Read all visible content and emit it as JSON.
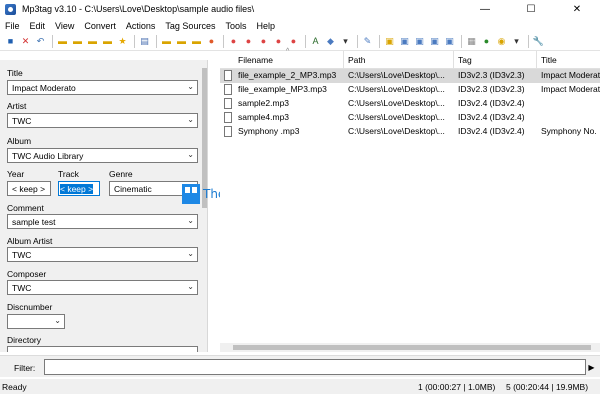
{
  "window": {
    "title": "Mp3tag v3.10  -  C:\\Users\\Love\\Desktop\\sample audio files\\",
    "minimize": "—",
    "maximize": "☐",
    "close": "✕"
  },
  "menu": [
    "File",
    "Edit",
    "View",
    "Convert",
    "Actions",
    "Tag Sources",
    "Tools",
    "Help"
  ],
  "toolbar": {
    "icons": [
      {
        "name": "save-icon",
        "glyph": "■",
        "color": "#1f5fb0"
      },
      {
        "name": "remove-tag-icon",
        "glyph": "✕",
        "color": "#d32f2f"
      },
      {
        "name": "undo-icon",
        "glyph": "↶",
        "color": "#3a6fb0"
      },
      {
        "name": "open-folder-icon",
        "glyph": "▬",
        "color": "#d9a400"
      },
      {
        "name": "add-folder-icon",
        "glyph": "▬",
        "color": "#d9a400"
      },
      {
        "name": "save-playlist-icon",
        "glyph": "▬",
        "color": "#d9a400"
      },
      {
        "name": "export-icon",
        "glyph": "▬",
        "color": "#d9a400"
      },
      {
        "name": "favorite-icon",
        "glyph": "★",
        "color": "#e6a800"
      },
      {
        "name": "options-icon",
        "glyph": "▤",
        "color": "#4a6fb0"
      },
      {
        "name": "filename-tag-icon",
        "glyph": "▬",
        "color": "#d9a400"
      },
      {
        "name": "tag-filename-icon",
        "glyph": "▬",
        "color": "#d9a400"
      },
      {
        "name": "text-tag-icon",
        "glyph": "▬",
        "color": "#d9a400"
      },
      {
        "name": "tag-tag-icon",
        "glyph": "●",
        "color": "#e05a2a"
      },
      {
        "name": "convert-1-icon",
        "glyph": "●",
        "color": "#d44"
      },
      {
        "name": "convert-2-icon",
        "glyph": "●",
        "color": "#d44"
      },
      {
        "name": "convert-3-icon",
        "glyph": "●",
        "color": "#d44"
      },
      {
        "name": "convert-4-icon",
        "glyph": "●",
        "color": "#d44"
      },
      {
        "name": "convert-5-icon",
        "glyph": "●",
        "color": "#d44"
      },
      {
        "name": "actions-icon",
        "glyph": "A",
        "color": "#2a6a2a"
      },
      {
        "name": "actions-quick-icon",
        "glyph": "◆",
        "color": "#4a7ac0"
      },
      {
        "name": "actions-dropdown-icon",
        "glyph": "▾",
        "color": "#333"
      },
      {
        "name": "edit-icon",
        "glyph": "✎",
        "color": "#4a7ac0"
      },
      {
        "name": "tag-source-icon",
        "glyph": "▣",
        "color": "#d9a400"
      },
      {
        "name": "id3-1-icon",
        "glyph": "▣",
        "color": "#4a7ac0"
      },
      {
        "name": "id3-2-icon",
        "glyph": "▣",
        "color": "#4a7ac0"
      },
      {
        "name": "id3-3-icon",
        "glyph": "▣",
        "color": "#4a7ac0"
      },
      {
        "name": "id3-4-icon",
        "glyph": "▣",
        "color": "#4a7ac0"
      },
      {
        "name": "tools-1-icon",
        "glyph": "▦",
        "color": "#888"
      },
      {
        "name": "tools-2-icon",
        "glyph": "●",
        "color": "#2a8a2a"
      },
      {
        "name": "web-icon",
        "glyph": "◉",
        "color": "#d9a400"
      },
      {
        "name": "web-dropdown-icon",
        "glyph": "▾",
        "color": "#333"
      },
      {
        "name": "settings-icon",
        "glyph": "🔧",
        "color": "#555"
      }
    ]
  },
  "tag_panel": {
    "title": {
      "label": "Title",
      "value": "Impact Moderato"
    },
    "artist": {
      "label": "Artist",
      "value": "TWC"
    },
    "album": {
      "label": "Album",
      "value": "TWC Audio Library"
    },
    "year": {
      "label": "Year",
      "value": "< keep >"
    },
    "track": {
      "label": "Track",
      "value": "< keep >"
    },
    "genre": {
      "label": "Genre",
      "value": "Cinematic"
    },
    "comment": {
      "label": "Comment",
      "value": "sample test"
    },
    "album_artist": {
      "label": "Album Artist",
      "value": "TWC"
    },
    "composer": {
      "label": "Composer",
      "value": "TWC"
    },
    "discnumber": {
      "label": "Discnumber",
      "value": ""
    },
    "directory": {
      "label": "Directory",
      "value": ""
    }
  },
  "watermark": {
    "text": "TheWindowsClub"
  },
  "file_list": {
    "columns": [
      "Filename",
      "Path",
      "Tag",
      "Title"
    ],
    "rows": [
      {
        "filename": "file_example_2_MP3.mp3",
        "path": "C:\\Users\\Love\\Desktop\\...",
        "tag": "ID3v2.3 (ID3v2.3)",
        "title": "Impact Moderato",
        "selected": true
      },
      {
        "filename": "file_example_MP3.mp3",
        "path": "C:\\Users\\Love\\Desktop\\...",
        "tag": "ID3v2.3 (ID3v2.3)",
        "title": "Impact Moderato",
        "selected": false
      },
      {
        "filename": "sample2.mp3",
        "path": "C:\\Users\\Love\\Desktop\\...",
        "tag": "ID3v2.4 (ID3v2.4)",
        "title": "",
        "selected": false
      },
      {
        "filename": "sample4.mp3",
        "path": "C:\\Users\\Love\\Desktop\\...",
        "tag": "ID3v2.4 (ID3v2.4)",
        "title": "",
        "selected": false
      },
      {
        "filename": "Symphony .mp3",
        "path": "C:\\Users\\Love\\Desktop\\...",
        "tag": "ID3v2.4 (ID3v2.4)",
        "title": "Symphony No.",
        "selected": false
      }
    ]
  },
  "filter": {
    "label": "Filter:",
    "value": ""
  },
  "status": {
    "ready": "Ready",
    "selection": "1 (00:00:27 | 1.0MB)",
    "total": "5 (00:20:44 | 19.9MB)"
  }
}
